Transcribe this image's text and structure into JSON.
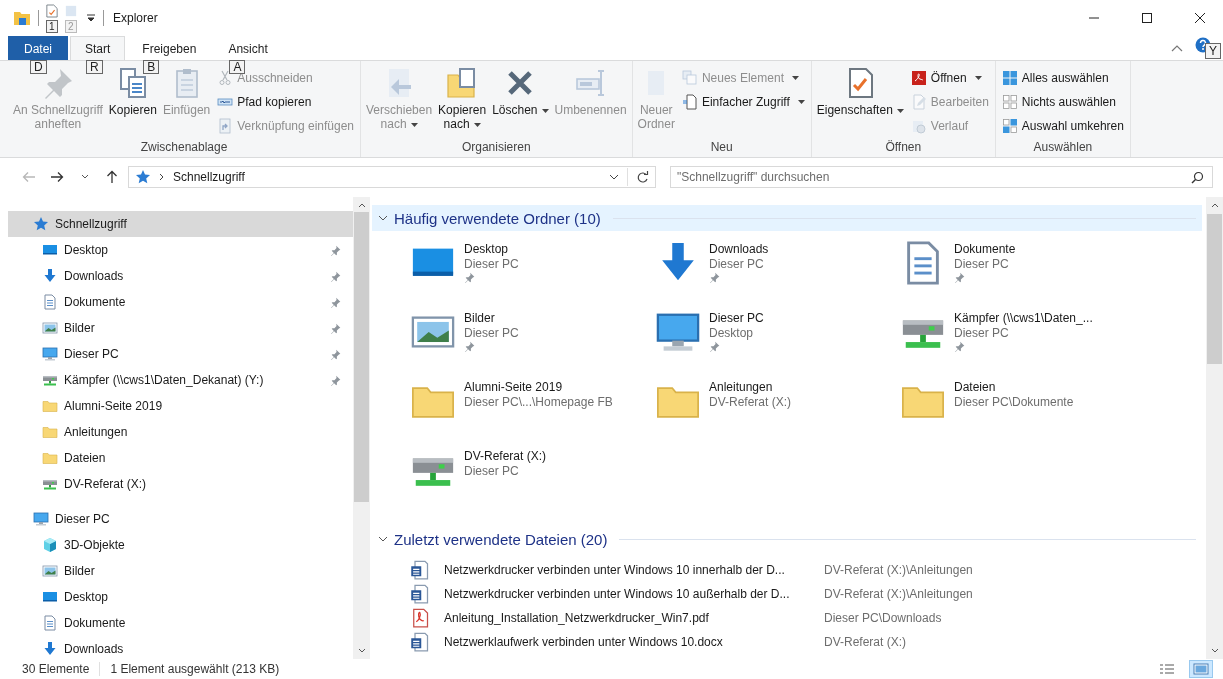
{
  "window": {
    "title": "Explorer"
  },
  "quick_access_toolbar": {
    "keytips": [
      "1",
      "2"
    ]
  },
  "tabs": [
    {
      "label": "Datei",
      "kind": "file",
      "selected": false,
      "keytip": "D"
    },
    {
      "label": "Start",
      "kind": "tab",
      "selected": true,
      "keytip": "R"
    },
    {
      "label": "Freigeben",
      "kind": "tab",
      "selected": false,
      "keytip": "B"
    },
    {
      "label": "Ansicht",
      "kind": "tab",
      "selected": false,
      "keytip": "A"
    }
  ],
  "help": {
    "keytip": "Y"
  },
  "ribbon": {
    "groups": [
      {
        "label": "Zwischenablage",
        "columns": [
          {
            "kind": "large",
            "label": "An Schnellzugriff\nanheften",
            "disabled": true,
            "dropdown": false
          },
          {
            "kind": "large",
            "label": "Kopieren",
            "disabled": false,
            "dropdown": false
          },
          {
            "kind": "large",
            "label": "Einfügen",
            "disabled": true,
            "dropdown": false
          },
          {
            "kind": "stack",
            "items": [
              {
                "label": "Ausschneiden",
                "disabled": true,
                "dropdown": false
              },
              {
                "label": "Pfad kopieren",
                "disabled": false,
                "dropdown": false
              },
              {
                "label": "Verknüpfung einfügen",
                "disabled": true,
                "dropdown": false
              }
            ]
          }
        ]
      },
      {
        "label": "Organisieren",
        "columns": [
          {
            "kind": "large",
            "label": "Verschieben\nnach",
            "disabled": true,
            "dropdown": true
          },
          {
            "kind": "large",
            "label": "Kopieren\nnach",
            "disabled": false,
            "dropdown": true
          },
          {
            "kind": "large",
            "label": "Löschen",
            "disabled": false,
            "dropdown": true
          },
          {
            "kind": "large",
            "label": "Umbenennen",
            "disabled": true,
            "dropdown": false
          }
        ]
      },
      {
        "label": "Neu",
        "columns": [
          {
            "kind": "large",
            "label": "Neuer\nOrdner",
            "disabled": true,
            "dropdown": false
          },
          {
            "kind": "stack",
            "items": [
              {
                "label": "Neues Element",
                "disabled": true,
                "dropdown": true
              },
              {
                "label": "Einfacher Zugriff",
                "disabled": false,
                "dropdown": true
              }
            ]
          }
        ]
      },
      {
        "label": "Öffnen",
        "columns": [
          {
            "kind": "large",
            "label": "Eigenschaften",
            "disabled": false,
            "dropdown": true
          },
          {
            "kind": "stack",
            "items": [
              {
                "label": "Öffnen",
                "disabled": false,
                "dropdown": true
              },
              {
                "label": "Bearbeiten",
                "disabled": true,
                "dropdown": false
              },
              {
                "label": "Verlauf",
                "disabled": true,
                "dropdown": false
              }
            ]
          }
        ]
      },
      {
        "label": "Auswählen",
        "columns": [
          {
            "kind": "stack",
            "items": [
              {
                "label": "Alles auswählen",
                "disabled": false,
                "dropdown": false
              },
              {
                "label": "Nichts auswählen",
                "disabled": false,
                "dropdown": false
              },
              {
                "label": "Auswahl umkehren",
                "disabled": false,
                "dropdown": false
              }
            ]
          }
        ]
      }
    ]
  },
  "address_bar": {
    "path": "Schnellzugriff",
    "back_disabled": true
  },
  "search": {
    "placeholder": "\"Schnellzugriff\" durchsuchen"
  },
  "navigation": {
    "items": [
      {
        "label": "Schnellzugriff",
        "kind": "quick",
        "selected": true,
        "children": [
          {
            "label": "Desktop",
            "kind": "desktop",
            "pinned": true,
            "selected": false
          },
          {
            "label": "Downloads",
            "kind": "downloads",
            "pinned": true,
            "selected": false
          },
          {
            "label": "Dokumente",
            "kind": "documents",
            "pinned": true,
            "selected": false
          },
          {
            "label": "Bilder",
            "kind": "pictures",
            "pinned": true,
            "selected": false
          },
          {
            "label": "Dieser PC",
            "kind": "pc",
            "pinned": true,
            "selected": false
          },
          {
            "label": "Kämpfer (\\\\cws1\\Daten_Dekanat) (Y:)",
            "kind": "netdrive",
            "pinned": true,
            "selected": false
          },
          {
            "label": "Alumni-Seite 2019",
            "kind": "folder",
            "pinned": false,
            "selected": false
          },
          {
            "label": "Anleitungen",
            "kind": "folder",
            "pinned": false,
            "selected": false
          },
          {
            "label": "Dateien",
            "kind": "folder",
            "pinned": false,
            "selected": false
          },
          {
            "label": "DV-Referat (X:)",
            "kind": "netdrive",
            "pinned": false,
            "selected": false
          }
        ]
      },
      {
        "label": "Dieser PC",
        "kind": "pc",
        "selected": false,
        "children": [
          {
            "label": "3D-Objekte",
            "kind": "cube",
            "pinned": false,
            "selected": false
          },
          {
            "label": "Bilder",
            "kind": "pictures",
            "pinned": false,
            "selected": false
          },
          {
            "label": "Desktop",
            "kind": "desktop",
            "pinned": false,
            "selected": false
          },
          {
            "label": "Dokumente",
            "kind": "documents",
            "pinned": false,
            "selected": false
          },
          {
            "label": "Downloads",
            "kind": "downloads",
            "pinned": false,
            "selected": false
          }
        ]
      }
    ]
  },
  "sections": [
    {
      "title": "Häufig verwendete Ordner (10)",
      "kind": "tiles",
      "expanded": true,
      "selected": true,
      "items": [
        {
          "name": "Desktop",
          "location": "Dieser PC",
          "kind": "desktop",
          "pinned": true
        },
        {
          "name": "Downloads",
          "location": "Dieser PC",
          "kind": "downloads",
          "pinned": true
        },
        {
          "name": "Dokumente",
          "location": "Dieser PC",
          "kind": "documents",
          "pinned": true
        },
        {
          "name": "Bilder",
          "location": "Dieser PC",
          "kind": "pictures",
          "pinned": true
        },
        {
          "name": "Dieser PC",
          "location": "Desktop",
          "kind": "pc",
          "pinned": true
        },
        {
          "name": "Kämpfer (\\\\cws1\\Daten_...",
          "location": "Dieser PC",
          "kind": "netdrive",
          "pinned": true
        },
        {
          "name": "Alumni-Seite 2019",
          "location": "Dieser PC\\...\\Homepage FB",
          "kind": "folder",
          "pinned": false
        },
        {
          "name": "Anleitungen",
          "location": "DV-Referat (X:)",
          "kind": "folder",
          "pinned": false
        },
        {
          "name": "Dateien",
          "location": "Dieser PC\\Dokumente",
          "kind": "folder",
          "pinned": false
        },
        {
          "name": "DV-Referat (X:)",
          "location": "Dieser PC",
          "kind": "netdrive",
          "pinned": false
        }
      ]
    },
    {
      "title": "Zuletzt verwendete Dateien (20)",
      "kind": "list",
      "expanded": true,
      "selected": false,
      "items": [
        {
          "name": "Netzwerkdrucker verbinden unter Windows 10 innerhalb der D...",
          "path": "DV-Referat (X:)\\Anleitungen",
          "kind": "word"
        },
        {
          "name": "Netzwerkdrucker verbinden unter Windows 10 außerhalb der D...",
          "path": "DV-Referat (X:)\\Anleitungen",
          "kind": "word"
        },
        {
          "name": "Anleitung_Installation_Netzwerkdrucker_Win7.pdf",
          "path": "Dieser PC\\Downloads",
          "kind": "pdf"
        },
        {
          "name": "Netzwerklaufwerk verbinden unter Windows 10.docx",
          "path": "DV-Referat (X:)",
          "kind": "word"
        }
      ]
    }
  ],
  "status_bar": {
    "item_count": "30 Elemente",
    "selection": "1 Element ausgewählt (213 KB)",
    "views": [
      {
        "kind": "details",
        "selected": false
      },
      {
        "kind": "tiles",
        "selected": true
      }
    ]
  }
}
